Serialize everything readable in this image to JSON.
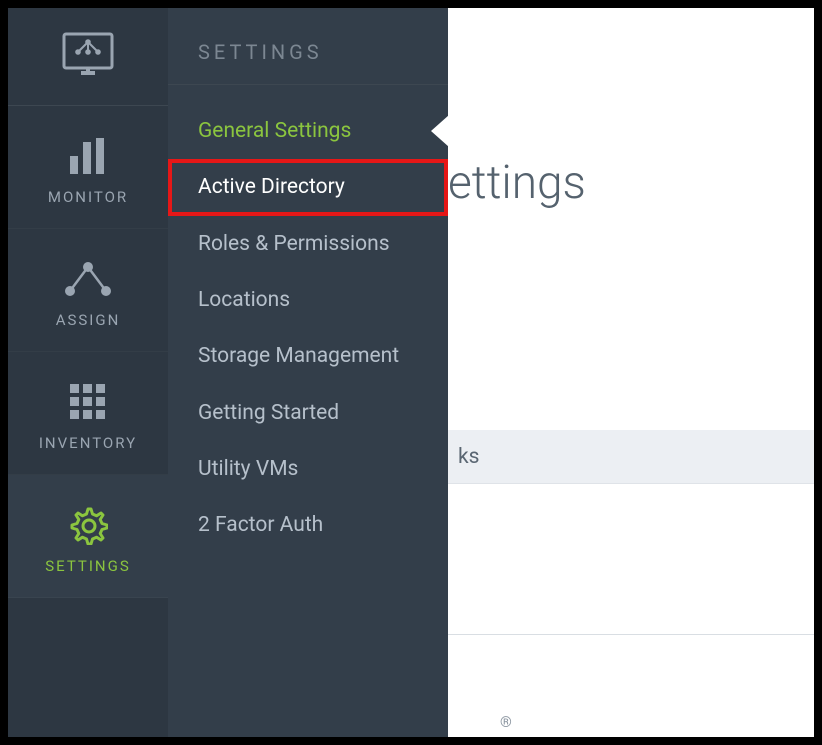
{
  "primary_nav": {
    "items": [
      {
        "label": "MONITOR"
      },
      {
        "label": "ASSIGN"
      },
      {
        "label": "INVENTORY"
      },
      {
        "label": "SETTINGS"
      }
    ]
  },
  "settings_menu": {
    "header": "SETTINGS",
    "items": [
      {
        "label": "General Settings"
      },
      {
        "label": "Active Directory"
      },
      {
        "label": "Roles & Permissions"
      },
      {
        "label": "Locations"
      },
      {
        "label": "Storage Management"
      },
      {
        "label": "Getting Started"
      },
      {
        "label": "Utility VMs"
      },
      {
        "label": "2 Factor Auth"
      }
    ]
  },
  "content": {
    "title_fragment": "ettings",
    "row_fragment": "ks",
    "reg": "®"
  },
  "colors": {
    "accent": "#8bc53f",
    "sidebar_primary": "#2d3742",
    "sidebar_secondary": "#333e4a",
    "highlight_border": "#e61717"
  }
}
